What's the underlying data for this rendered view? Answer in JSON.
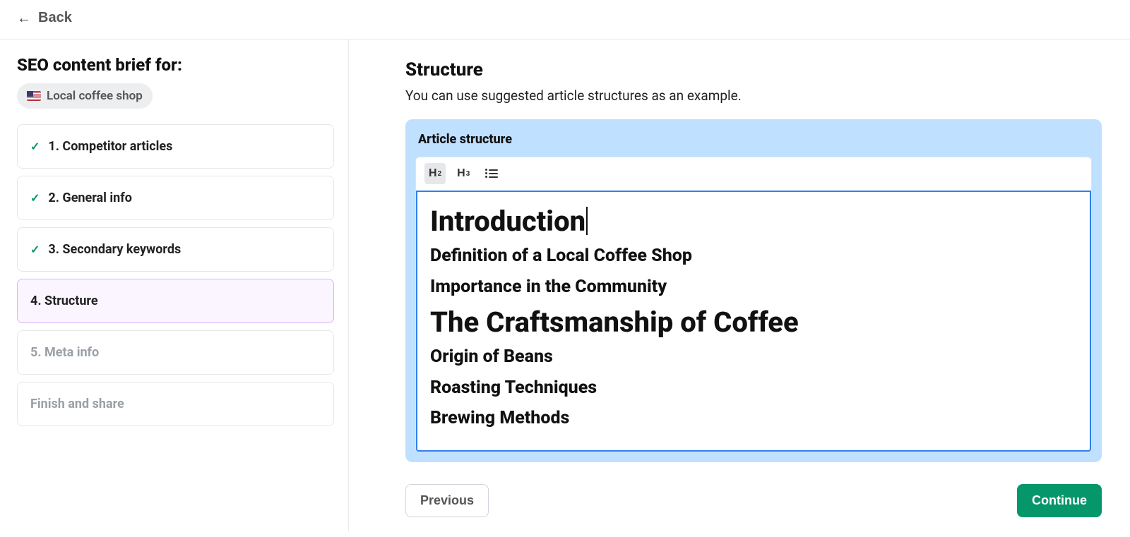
{
  "topbar": {
    "back_label": "Back"
  },
  "sidebar": {
    "title": "SEO content brief for:",
    "keyword": "Local coffee shop",
    "steps": [
      {
        "label": "1. Competitor articles",
        "done": true
      },
      {
        "label": "2. General info",
        "done": true
      },
      {
        "label": "3. Secondary keywords",
        "done": true
      },
      {
        "label": "4. Structure",
        "active": true
      },
      {
        "label": "5. Meta info",
        "muted": true
      },
      {
        "label": "Finish and share",
        "muted": true
      }
    ]
  },
  "main": {
    "title": "Structure",
    "subtitle": "You can use suggested article structures as an example.",
    "card_title": "Article structure",
    "toolbar": {
      "h2": "H",
      "h2_sub": "2",
      "h3": "H",
      "h3_sub": "3"
    },
    "structure": [
      {
        "level": "h2",
        "text": "Introduction"
      },
      {
        "level": "h3",
        "text": "Definition of a Local Coffee Shop"
      },
      {
        "level": "h3",
        "text": "Importance in the Community"
      },
      {
        "level": "h2",
        "text": "The Craftsmanship of Coffee"
      },
      {
        "level": "h3",
        "text": "Origin of Beans"
      },
      {
        "level": "h3",
        "text": "Roasting Techniques"
      },
      {
        "level": "h3",
        "text": "Brewing Methods"
      }
    ]
  },
  "footer": {
    "previous": "Previous",
    "continue": "Continue"
  }
}
